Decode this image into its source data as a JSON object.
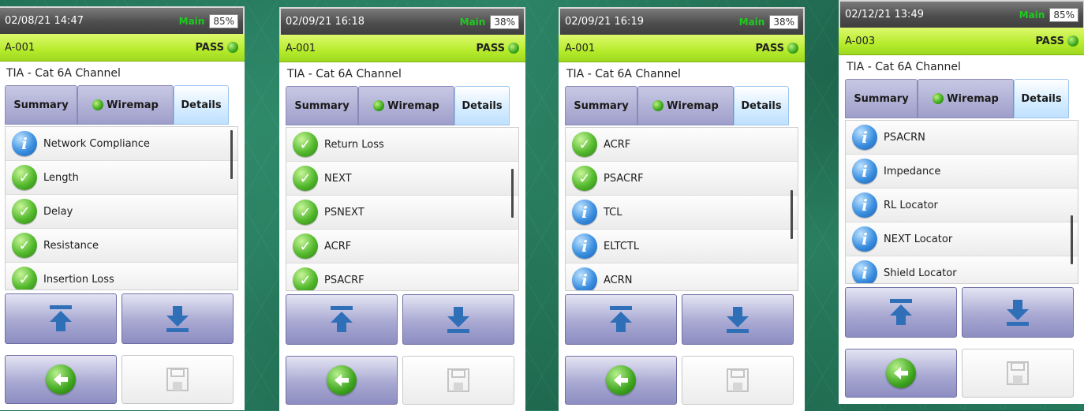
{
  "colors": {
    "pass_green": "#3aa51b",
    "id_bar": "#b6ec2c",
    "tab_purple": "#9e9ecb",
    "tab_active": "#d4ecff"
  },
  "screens": [
    {
      "status": {
        "datetime": "02/08/21 14:47",
        "mode": "Main",
        "battery": "85%"
      },
      "id": "A-001",
      "result": "PASS",
      "standard": "TIA - Cat 6A Channel",
      "tabs": [
        "Summary",
        "Wiremap",
        "Details"
      ],
      "items": [
        {
          "label": "Network Compliance",
          "icon": "info-icon"
        },
        {
          "label": "Length",
          "icon": "check-icon"
        },
        {
          "label": "Delay",
          "icon": "check-icon"
        },
        {
          "label": "Resistance",
          "icon": "check-icon"
        },
        {
          "label": "Insertion Loss",
          "icon": "check-icon"
        }
      ],
      "scroll_position": 0.0
    },
    {
      "status": {
        "datetime": "02/09/21 16:18",
        "mode": "Main",
        "battery": "38%"
      },
      "id": "A-001",
      "result": "PASS",
      "standard": "TIA - Cat 6A Channel",
      "tabs": [
        "Summary",
        "Wiremap",
        "Details"
      ],
      "items": [
        {
          "label": "Return Loss",
          "icon": "check-icon"
        },
        {
          "label": "NEXT",
          "icon": "check-icon"
        },
        {
          "label": "PSNEXT",
          "icon": "check-icon"
        },
        {
          "label": "ACRF",
          "icon": "check-icon"
        },
        {
          "label": "PSACRF",
          "icon": "check-icon"
        }
      ],
      "scroll_position": 0.35
    },
    {
      "status": {
        "datetime": "02/09/21 16:19",
        "mode": "Main",
        "battery": "38%"
      },
      "id": "A-001",
      "result": "PASS",
      "standard": "TIA - Cat 6A Channel",
      "tabs": [
        "Summary",
        "Wiremap",
        "Details"
      ],
      "items": [
        {
          "label": "ACRF",
          "icon": "check-icon"
        },
        {
          "label": "PSACRF",
          "icon": "check-icon"
        },
        {
          "label": "TCL",
          "icon": "info-icon"
        },
        {
          "label": "ELTCTL",
          "icon": "info-icon"
        },
        {
          "label": "ACRN",
          "icon": "info-icon"
        }
      ],
      "scroll_position": 0.55
    },
    {
      "status": {
        "datetime": "02/12/21 13:49",
        "mode": "Main",
        "battery": "85%"
      },
      "id": "A-003",
      "result": "PASS",
      "standard": "TIA - Cat 6A Channel",
      "tabs": [
        "Summary",
        "Wiremap",
        "Details"
      ],
      "items": [
        {
          "label": "PSACRN",
          "icon": "info-icon"
        },
        {
          "label": "Impedance",
          "icon": "info-icon"
        },
        {
          "label": "RL Locator",
          "icon": "info-icon"
        },
        {
          "label": "NEXT Locator",
          "icon": "info-icon"
        },
        {
          "label": "Shield Locator",
          "icon": "info-icon"
        }
      ],
      "scroll_position": 0.85
    }
  ]
}
